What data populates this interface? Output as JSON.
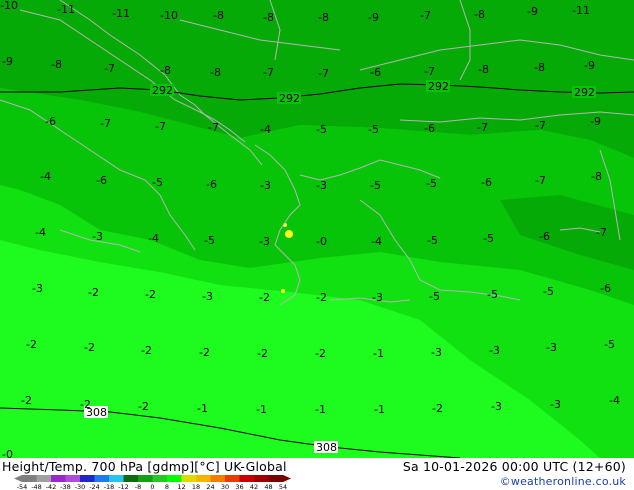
{
  "header": {
    "title": "Height/Temp. 700 hPa [gdmp][°C] UK-Global",
    "datetime": "Sa 10-01-2026 00:00 UTC (12+60)",
    "credit": "©weatheronline.co.uk"
  },
  "legend": {
    "ticks": [
      "-54",
      "-48",
      "-42",
      "-38",
      "-30",
      "-24",
      "-18",
      "-12",
      "-8",
      "0",
      "8",
      "12",
      "18",
      "24",
      "30",
      "36",
      "42",
      "48",
      "54"
    ],
    "colors": [
      "#7f7f7f",
      "#a0a0a0",
      "#9b27c9",
      "#b04dd8",
      "#1c28c8",
      "#1e7cf0",
      "#29c3f4",
      "#0e6b0e",
      "#14a014",
      "#25c825",
      "#00ff00",
      "#dcdc00",
      "#f4b400",
      "#f47c00",
      "#e83c00",
      "#c80000",
      "#a00000",
      "#7a0000"
    ]
  },
  "map": {
    "colors": {
      "dark": "#06aa06",
      "mid": "#08c408",
      "light": "#11e011",
      "bright": "#1efb1e",
      "coast": "#b4b4b4",
      "contour": "#000000",
      "yellow": "#ffff1e"
    },
    "height_contours": [
      {
        "label": "292"
      },
      {
        "label": "292"
      },
      {
        "label": "292"
      },
      {
        "label": "292"
      },
      {
        "label": "308"
      },
      {
        "label": "308"
      }
    ],
    "temperature_labels": [
      "-10",
      "-11",
      "-11",
      "-10",
      "-8",
      "-8",
      "-8",
      "-9",
      "-7",
      "-8",
      "-9",
      "-11",
      "-9",
      "-8",
      "-7",
      "-8",
      "-8",
      "-7",
      "-7",
      "-6",
      "-7",
      "-8",
      "-8",
      "-9",
      "-6",
      "-7",
      "-7",
      "-7",
      "-4",
      "-5",
      "-5",
      "-6",
      "-7",
      "-7",
      "-9",
      "-4",
      "-6",
      "-5",
      "-6",
      "-3",
      "-3",
      "-5",
      "-5",
      "-6",
      "-7",
      "-8",
      "-4",
      "-3",
      "-4",
      "-5",
      "-3",
      "-0",
      "-4",
      "-5",
      "-5",
      "-6",
      "-7",
      "-3",
      "-2",
      "-2",
      "-3",
      "-2",
      "-2",
      "-3",
      "-5",
      "-5",
      "-5",
      "-6",
      "-2",
      "-2",
      "-2",
      "-2",
      "-2",
      "-2",
      "-1",
      "-3",
      "-3",
      "-3",
      "-5",
      "-2",
      "-2",
      "-2",
      "-1",
      "-1",
      "-1",
      "-1",
      "-2",
      "-3",
      "-3",
      "-4",
      "-0"
    ]
  }
}
